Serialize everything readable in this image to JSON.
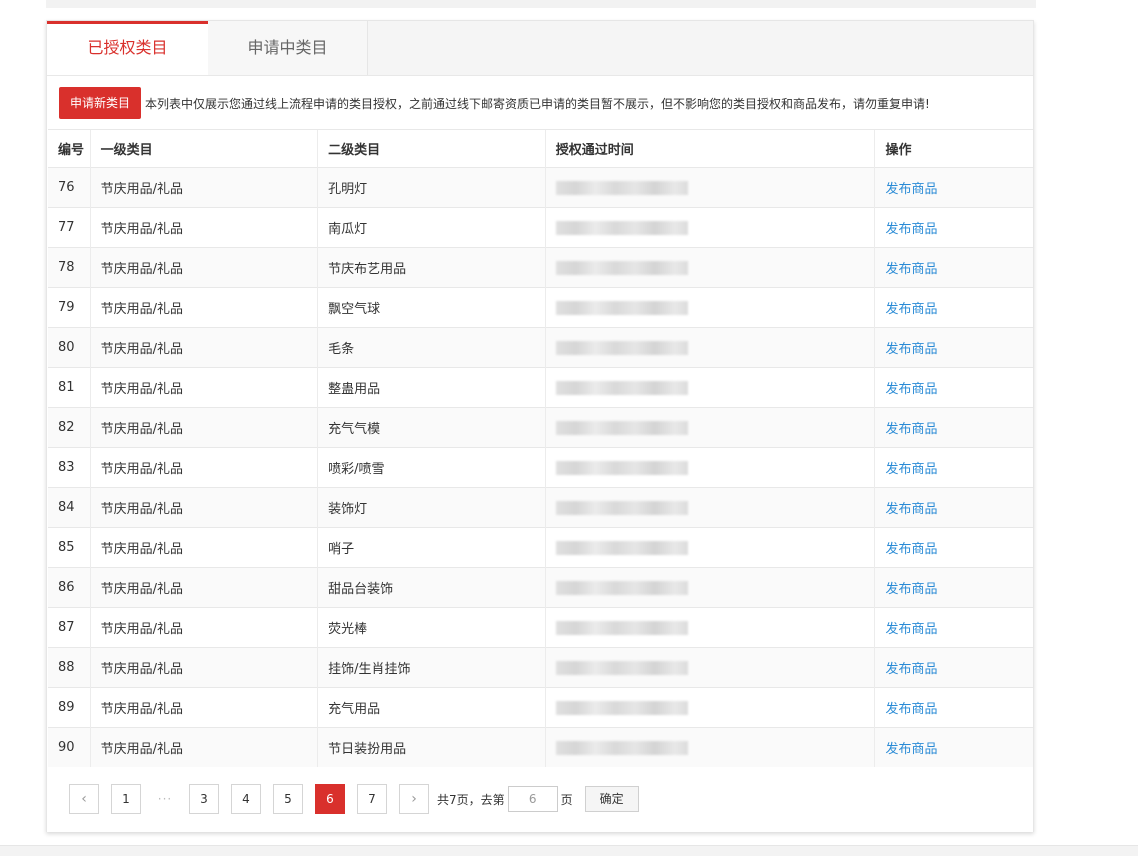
{
  "tabs": [
    {
      "label": "已授权类目",
      "active": true
    },
    {
      "label": "申请中类目",
      "active": false
    }
  ],
  "notice": {
    "button_label": "申请新类目",
    "text": "本列表中仅展示您通过线上流程申请的类目授权，之前通过线下邮寄资质已申请的类目暂不展示，但不影响您的类目授权和商品发布，请勿重复申请!"
  },
  "table": {
    "headers": [
      "编号",
      "一级类目",
      "二级类目",
      "授权通过时间",
      "操作"
    ],
    "rows": [
      {
        "id": "76",
        "level1": "节庆用品/礼品",
        "level2": "孔明灯",
        "action": "发布商品"
      },
      {
        "id": "77",
        "level1": "节庆用品/礼品",
        "level2": "南瓜灯",
        "action": "发布商品"
      },
      {
        "id": "78",
        "level1": "节庆用品/礼品",
        "level2": "节庆布艺用品",
        "action": "发布商品"
      },
      {
        "id": "79",
        "level1": "节庆用品/礼品",
        "level2": "飘空气球",
        "action": "发布商品"
      },
      {
        "id": "80",
        "level1": "节庆用品/礼品",
        "level2": "毛条",
        "action": "发布商品"
      },
      {
        "id": "81",
        "level1": "节庆用品/礼品",
        "level2": "整蛊用品",
        "action": "发布商品"
      },
      {
        "id": "82",
        "level1": "节庆用品/礼品",
        "level2": "充气气模",
        "action": "发布商品"
      },
      {
        "id": "83",
        "level1": "节庆用品/礼品",
        "level2": "喷彩/喷雪",
        "action": "发布商品"
      },
      {
        "id": "84",
        "level1": "节庆用品/礼品",
        "level2": "装饰灯",
        "action": "发布商品"
      },
      {
        "id": "85",
        "level1": "节庆用品/礼品",
        "level2": "哨子",
        "action": "发布商品"
      },
      {
        "id": "86",
        "level1": "节庆用品/礼品",
        "level2": "甜品台装饰",
        "action": "发布商品"
      },
      {
        "id": "87",
        "level1": "节庆用品/礼品",
        "level2": "荧光棒",
        "action": "发布商品"
      },
      {
        "id": "88",
        "level1": "节庆用品/礼品",
        "level2": "挂饰/生肖挂饰",
        "action": "发布商品"
      },
      {
        "id": "89",
        "level1": "节庆用品/礼品",
        "level2": "充气用品",
        "action": "发布商品"
      },
      {
        "id": "90",
        "level1": "节庆用品/礼品",
        "level2": "节日装扮用品",
        "action": "发布商品"
      }
    ]
  },
  "pagination": {
    "prev_icon": "chevron-left-icon",
    "next_icon": "chevron-right-icon",
    "pages": [
      "1",
      "3",
      "4",
      "5",
      "6",
      "7"
    ],
    "ellipsis": "···",
    "current": "6",
    "total_text": "共7页，去第",
    "goto_value": "6",
    "page_unit": "页",
    "confirm_label": "确定"
  },
  "colors": {
    "accent": "#d9302c",
    "link": "#2a8bd6"
  }
}
